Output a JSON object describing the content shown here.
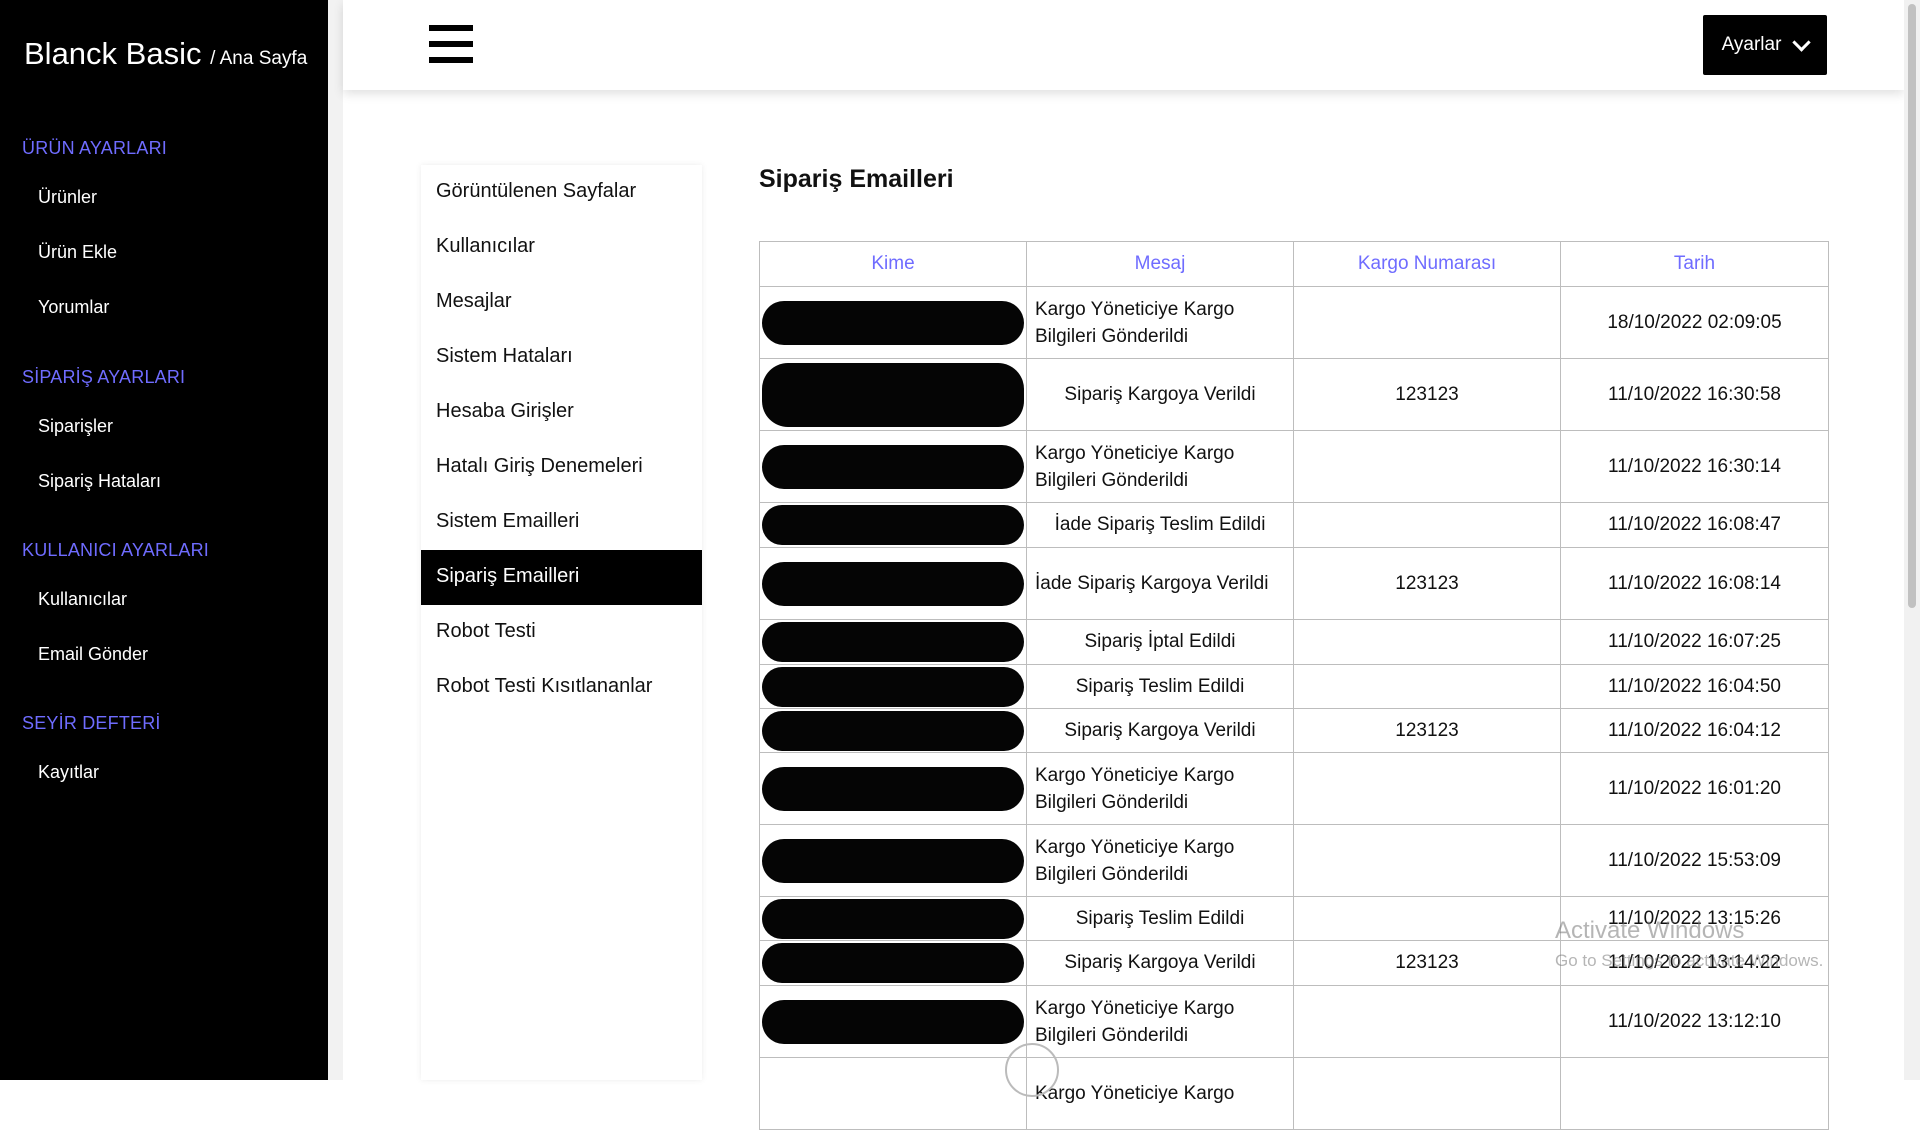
{
  "brand": {
    "title": "Blanck Basic",
    "crumb": "/ Ana Sayfa"
  },
  "sidebar": {
    "sections": [
      {
        "title": "ÜRÜN AYARLARI",
        "items": [
          "Ürünler",
          "Ürün Ekle",
          "Yorumlar"
        ]
      },
      {
        "title": "SİPARİŞ AYARLARI",
        "items": [
          "Siparişler",
          "Sipariş Hataları"
        ]
      },
      {
        "title": "KULLANICI AYARLARI",
        "items": [
          "Kullanıcılar",
          "Email Gönder"
        ]
      },
      {
        "title": "SEYİR DEFTERİ",
        "items": [
          "Kayıtlar"
        ]
      }
    ]
  },
  "topbar": {
    "settings_label": "Ayarlar"
  },
  "menu": {
    "items": [
      "Görüntülenen Sayfalar",
      "Kullanıcılar",
      "Mesajlar",
      "Sistem Hataları",
      "Hesaba Girişler",
      "Hatalı Giriş Denemeleri",
      "Sistem Emailleri",
      "Sipariş Emailleri",
      "Robot Testi",
      "Robot Testi Kısıtlananlar"
    ],
    "active_index": 7
  },
  "main": {
    "title": "Sipariş Emailleri",
    "columns": [
      "Kime",
      "Mesaj",
      "Kargo Numarası",
      "Tarih"
    ],
    "rows": [
      {
        "kime": "",
        "mesaj": "Kargo Yöneticiye Kargo Bilgileri Gönderildi",
        "kargo": "",
        "tarih": "18/10/2022 02:09:05"
      },
      {
        "kime": "",
        "mesaj": "Sipariş Kargoya Verildi",
        "kargo": "123123",
        "tarih": "11/10/2022 16:30:58"
      },
      {
        "kime": "",
        "mesaj": "Kargo Yöneticiye Kargo Bilgileri Gönderildi",
        "kargo": "",
        "tarih": "11/10/2022 16:30:14"
      },
      {
        "kime": "",
        "mesaj": "İade Sipariş Teslim Edildi",
        "kargo": "",
        "tarih": "11/10/2022 16:08:47"
      },
      {
        "kime": "",
        "mesaj": "İade Sipariş Kargoya Verildi",
        "kargo": "123123",
        "tarih": "11/10/2022 16:08:14"
      },
      {
        "kime": "",
        "mesaj": "Sipariş İptal Edildi",
        "kargo": "",
        "tarih": "11/10/2022 16:07:25"
      },
      {
        "kime": "",
        "mesaj": "Sipariş Teslim Edildi",
        "kargo": "",
        "tarih": "11/10/2022 16:04:50"
      },
      {
        "kime": "",
        "mesaj": "Sipariş Kargoya Verildi",
        "kargo": "123123",
        "tarih": "11/10/2022 16:04:12"
      },
      {
        "kime": "",
        "mesaj": "Kargo Yöneticiye Kargo Bilgileri Gönderildi",
        "kargo": "",
        "tarih": "11/10/2022 16:01:20"
      },
      {
        "kime": "",
        "mesaj": "Kargo Yöneticiye Kargo Bilgileri Gönderildi",
        "kargo": "",
        "tarih": "11/10/2022 15:53:09"
      },
      {
        "kime": "",
        "mesaj": "Sipariş Teslim Edildi",
        "kargo": "",
        "tarih": "11/10/2022 13:15:26"
      },
      {
        "kime": "",
        "mesaj": "Sipariş Kargoya Verildi",
        "kargo": "123123",
        "tarih": "11/10/2022 13:14:22"
      },
      {
        "kime": "",
        "mesaj": "Kargo Yöneticiye Kargo Bilgileri Gönderildi",
        "kargo": "",
        "tarih": "11/10/2022 13:12:10"
      },
      {
        "kime": "",
        "mesaj": "Kargo Yöneticiye Kargo",
        "kargo": "",
        "tarih": ""
      }
    ]
  },
  "watermark": {
    "line1": "Activate Windows",
    "line2": "Go to Settings to activate Windows."
  },
  "colors": {
    "accent": "#6f6cff",
    "sidebar_bg": "#000000",
    "active_bg": "#000000"
  }
}
